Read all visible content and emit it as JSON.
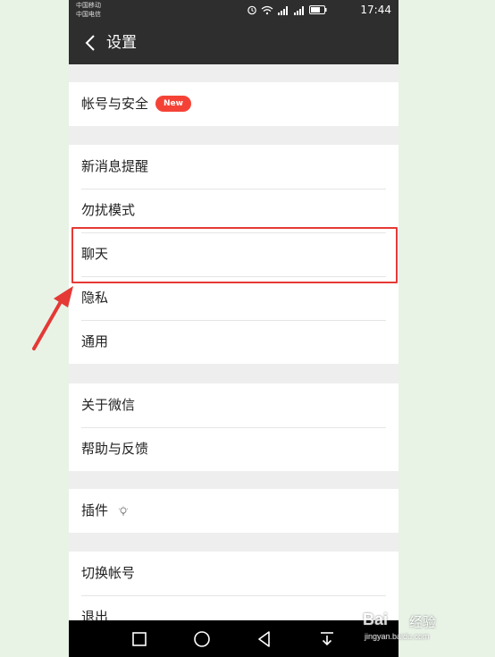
{
  "status_bar": {
    "carrier_1": "中国移动",
    "carrier_2": "中国电信",
    "time": "17:44"
  },
  "header": {
    "title": "设置"
  },
  "groups": [
    {
      "items": [
        {
          "label": "帐号与安全",
          "badge": "New"
        }
      ]
    },
    {
      "items": [
        {
          "label": "新消息提醒"
        },
        {
          "label": "勿扰模式"
        },
        {
          "label": "聊天"
        },
        {
          "label": "隐私"
        },
        {
          "label": "通用"
        }
      ]
    },
    {
      "items": [
        {
          "label": "关于微信"
        },
        {
          "label": "帮助与反馈"
        }
      ]
    },
    {
      "items": [
        {
          "label": "插件"
        }
      ]
    },
    {
      "items": [
        {
          "label": "切换帐号"
        },
        {
          "label": "退出"
        }
      ]
    }
  ],
  "annotation": {
    "highlighted_item": "聊天",
    "color": "#e53935"
  },
  "watermark": {
    "brand": "Bai",
    "suffix": "经验",
    "url": "jingyan.baidu.com"
  },
  "colors": {
    "title_bar": "#2e2e2e",
    "badge": "#f44336",
    "background": "#eeeeee"
  }
}
